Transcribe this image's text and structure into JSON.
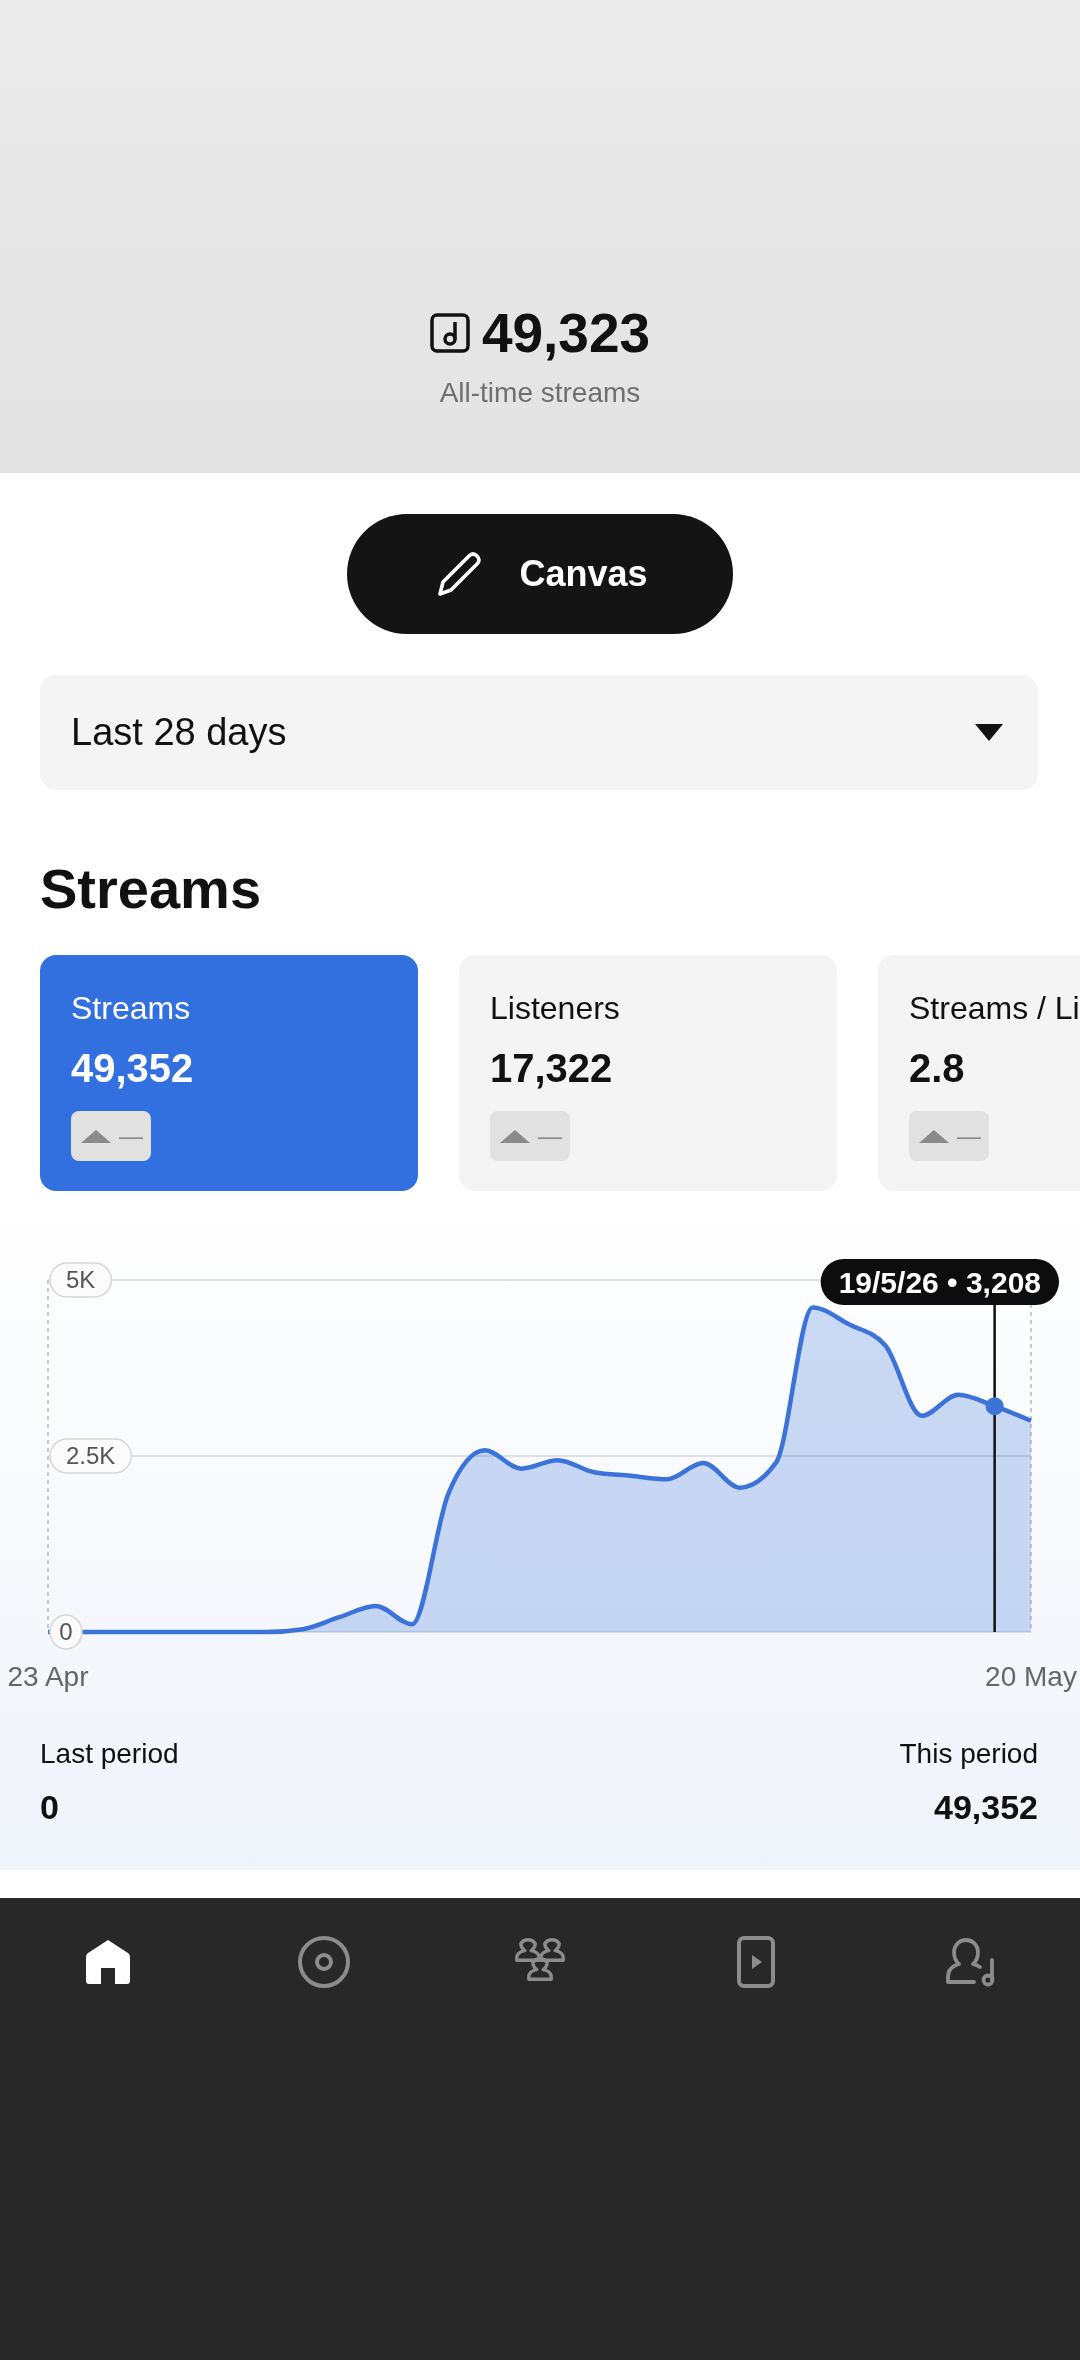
{
  "header": {
    "total": "49,323",
    "caption": "All-time streams"
  },
  "canvas_button": {
    "label": "Canvas"
  },
  "period_dropdown": {
    "value": "Last 28 days"
  },
  "section_title": "Streams",
  "metric_cards": [
    {
      "label": "Streams",
      "value": "49,352",
      "change": "—",
      "selected": true
    },
    {
      "label": "Listeners",
      "value": "17,322",
      "change": "—",
      "selected": false
    },
    {
      "label": "Streams / Li",
      "value": "2.8",
      "change": "—",
      "selected": false
    }
  ],
  "chart": {
    "chart_data": {
      "type": "area",
      "categories": [
        "23 Apr",
        null,
        null,
        null,
        null,
        null,
        null,
        null,
        null,
        null,
        null,
        null,
        null,
        null,
        null,
        null,
        null,
        null,
        null,
        null,
        null,
        null,
        null,
        null,
        null,
        null,
        null,
        "20 May"
      ],
      "ylim": [
        0,
        5000
      ],
      "yticks": [
        {
          "value": 0,
          "label": "0"
        },
        {
          "value": 2500,
          "label": "2.5K"
        },
        {
          "value": 5000,
          "label": "5K"
        }
      ],
      "series": [
        {
          "color": "#3b73d9",
          "values": [
            0,
            0,
            0,
            0,
            0,
            0,
            0,
            40,
            210,
            370,
            110,
            1970,
            2580,
            2320,
            2440,
            2270,
            2220,
            2170,
            2400,
            2050,
            2410,
            4610,
            4370,
            4070,
            3070,
            3370,
            3208,
            3000
          ]
        }
      ],
      "annotations": [
        "19/5/26 • 3,208"
      ]
    },
    "cursor": {
      "level": 0.963
    }
  },
  "comparison": [
    {
      "label": "Last period",
      "value": "0"
    },
    {
      "label": "This period",
      "value": "49,352"
    }
  ],
  "nav": [
    {
      "kind": "home",
      "selected": true
    },
    {
      "kind": "disc",
      "selected": false
    },
    {
      "kind": "people",
      "selected": false
    },
    {
      "kind": "video",
      "selected": false
    },
    {
      "kind": "artist",
      "selected": false
    }
  ]
}
